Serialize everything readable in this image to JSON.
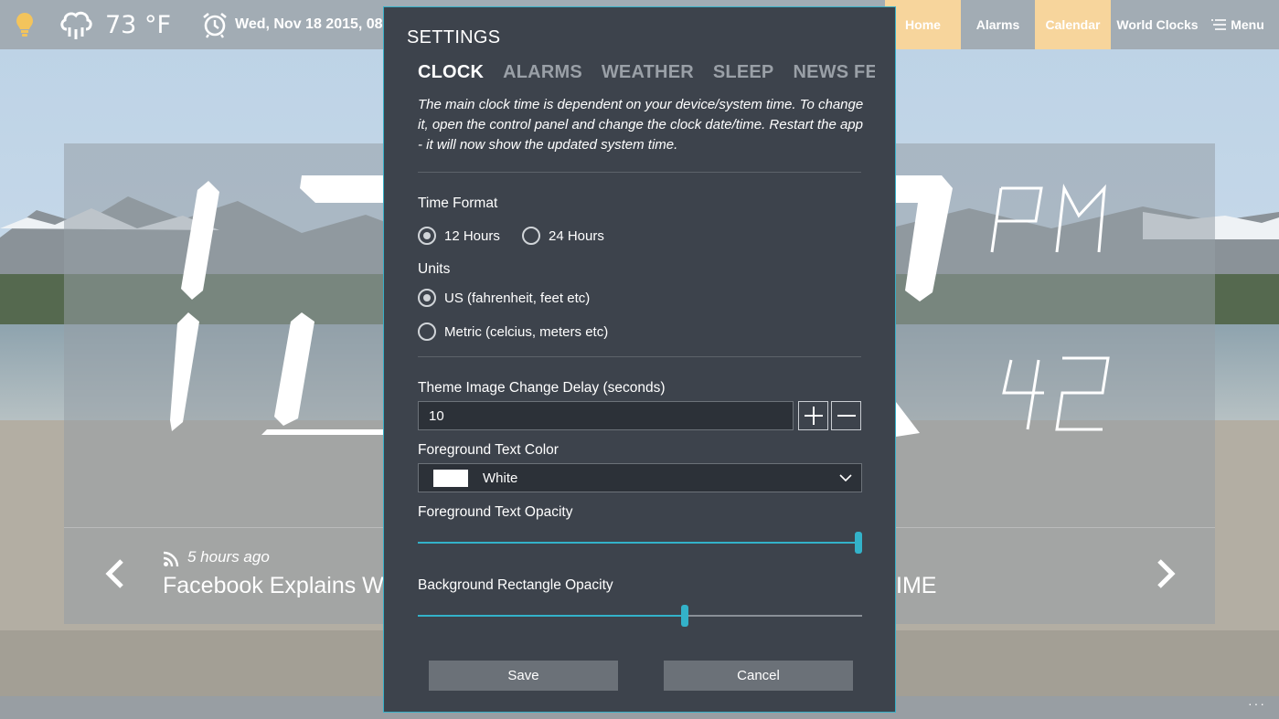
{
  "colors": {
    "accent": "#33b2c9",
    "nav_active": "#f7d59c",
    "dialog_bg": "#3d434c"
  },
  "topbar": {
    "bulb_icon": "lightbulb-icon",
    "weather_icon": "rain-cloud-icon",
    "temperature": "73 °F",
    "alarm_icon": "alarm-clock-icon",
    "date": "Wed, Nov 18 2015, 08:",
    "nav": [
      {
        "label": "Home",
        "active": true
      },
      {
        "label": "Alarms",
        "active": false
      },
      {
        "label": "Calendar",
        "active": true
      },
      {
        "label": "World Clocks",
        "active": false
      }
    ],
    "menu_label": "Menu",
    "menu_icon": "hamburger-menu-icon"
  },
  "clock": {
    "period": "PM",
    "seconds": "42"
  },
  "news": {
    "rss_icon": "rss-icon",
    "time_ago": "5 hours ago",
    "title_left": "Facebook Explains W",
    "title_right": "IME"
  },
  "settings": {
    "title": "SETTINGS",
    "tabs": [
      {
        "label": "CLOCK",
        "active": true
      },
      {
        "label": "ALARMS",
        "active": false
      },
      {
        "label": "WEATHER",
        "active": false
      },
      {
        "label": "SLEEP",
        "active": false
      },
      {
        "label": "NEWS FEED",
        "active": false
      }
    ],
    "description": "The main clock time is dependent on your device/system time. To change it, open the control panel and change the clock date/time. Restart the app - it will now show the updated system time.",
    "time_format": {
      "label": "Time Format",
      "options": [
        {
          "label": "12 Hours",
          "selected": true
        },
        {
          "label": "24 Hours",
          "selected": false
        }
      ]
    },
    "units": {
      "label": "Units",
      "options": [
        {
          "label": "US (fahrenheit, feet etc)",
          "selected": true
        },
        {
          "label": "Metric (celcius, meters etc)",
          "selected": false
        }
      ]
    },
    "theme_delay": {
      "label": "Theme Image Change Delay (seconds)",
      "value": "10"
    },
    "fg_color": {
      "label": "Foreground Text Color",
      "value": "White",
      "swatch": "#ffffff"
    },
    "fg_opacity": {
      "label": "Foreground Text Opacity",
      "value": 1.0
    },
    "bg_opacity": {
      "label": "Background Rectangle Opacity",
      "value": 0.6
    },
    "save_label": "Save",
    "cancel_label": "Cancel"
  }
}
